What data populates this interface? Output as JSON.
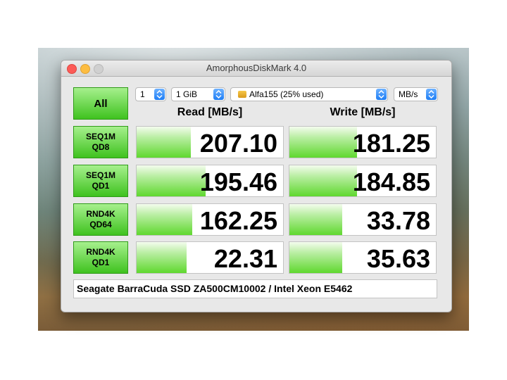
{
  "window": {
    "title": "AmorphousDiskMark 4.0"
  },
  "controls": {
    "all_label": "All",
    "count_value": "1",
    "size_value": "1 GiB",
    "drive_value": "Alfa155 (25% used)",
    "unit_value": "MB/s"
  },
  "headers": {
    "read": "Read [MB/s]",
    "write": "Write [MB/s]"
  },
  "rows": [
    {
      "line1": "SEQ1M",
      "line2": "QD8",
      "read": "207.10",
      "write": "181.25",
      "read_fill": 0.37,
      "write_fill": 0.46
    },
    {
      "line1": "SEQ1M",
      "line2": "QD1",
      "read": "195.46",
      "write": "184.85",
      "read_fill": 0.47,
      "write_fill": 0.46
    },
    {
      "line1": "RND4K",
      "line2": "QD64",
      "read": "162.25",
      "write": "33.78",
      "read_fill": 0.38,
      "write_fill": 0.36
    },
    {
      "line1": "RND4K",
      "line2": "QD1",
      "read": "22.31",
      "write": "35.63",
      "read_fill": 0.34,
      "write_fill": 0.36
    }
  ],
  "info": {
    "description": "Seagate BarraCuda SSD ZA500CM10002 / Intel Xeon E5462"
  },
  "colors": {
    "button_green": "#3fc21f",
    "bar_green": "#5fd82f",
    "stepper_blue": "#1d7df5"
  }
}
